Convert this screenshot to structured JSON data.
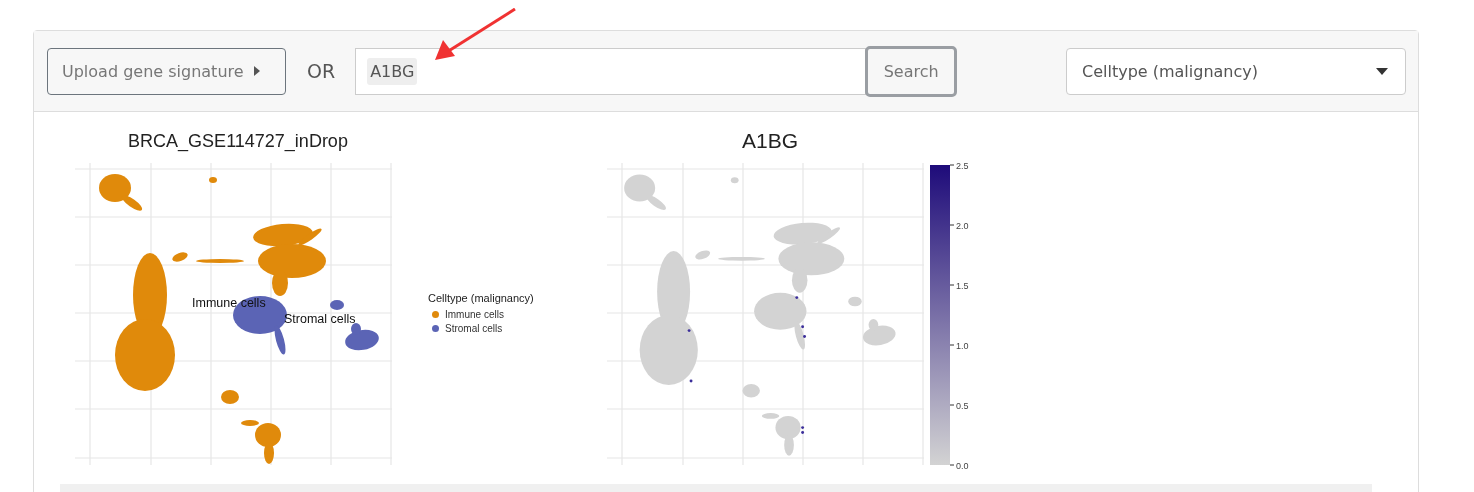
{
  "toolbar": {
    "upload_button": {
      "label": "Upload gene signature"
    },
    "or_label": "OR",
    "search": {
      "value": "A1BG"
    },
    "search_button": {
      "label": "Search"
    },
    "dropdown": {
      "value": "Celltype (malignancy)"
    }
  },
  "plots": [
    {
      "kind": "category",
      "title": "BRCA_GSE114727_inDrop",
      "cluster_labels": [
        "Immune cells",
        "Stromal cells"
      ],
      "legend": {
        "title": "Celltype (malignancy)",
        "items": [
          {
            "label": "Immune cells",
            "color": "#e08a0b"
          },
          {
            "label": "Stromal cells",
            "color": "#5b64b5"
          }
        ]
      }
    },
    {
      "kind": "expression",
      "title": "A1BG",
      "colorbar": {
        "ticks": [
          "2.5",
          "2.0",
          "1.5",
          "1.0",
          "0.5",
          "0.0"
        ]
      }
    }
  ]
}
